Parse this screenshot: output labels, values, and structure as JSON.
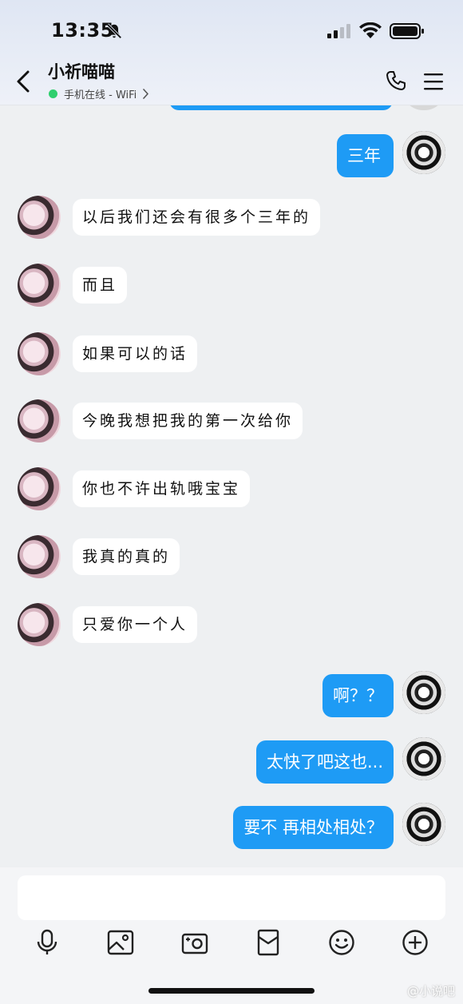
{
  "status_bar": {
    "time": "13:35"
  },
  "header": {
    "title": "小祈喵喵",
    "online_status": "手机在线 - WiFi"
  },
  "messages": [
    {
      "side": "out",
      "text": "三年"
    },
    {
      "side": "in",
      "text": "以后我们还会有很多个三年的"
    },
    {
      "side": "in",
      "text": "而且"
    },
    {
      "side": "in",
      "text": "如果可以的话"
    },
    {
      "side": "in",
      "text": "今晚我想把我的第一次给你"
    },
    {
      "side": "in",
      "text": "你也不许出轨哦宝宝"
    },
    {
      "side": "in",
      "text": "我真的真的"
    },
    {
      "side": "in",
      "text": "只爱你一个人"
    },
    {
      "side": "out",
      "text": "啊？？"
    },
    {
      "side": "out",
      "text": "太快了吧这也..."
    },
    {
      "side": "out",
      "text": "要不 再相处相处？"
    }
  ],
  "toolbar": {
    "icons": [
      "microphone-icon",
      "image-icon",
      "camera-icon",
      "red-packet-icon",
      "emoji-icon",
      "plus-icon"
    ]
  },
  "watermark": "@小说吧"
}
